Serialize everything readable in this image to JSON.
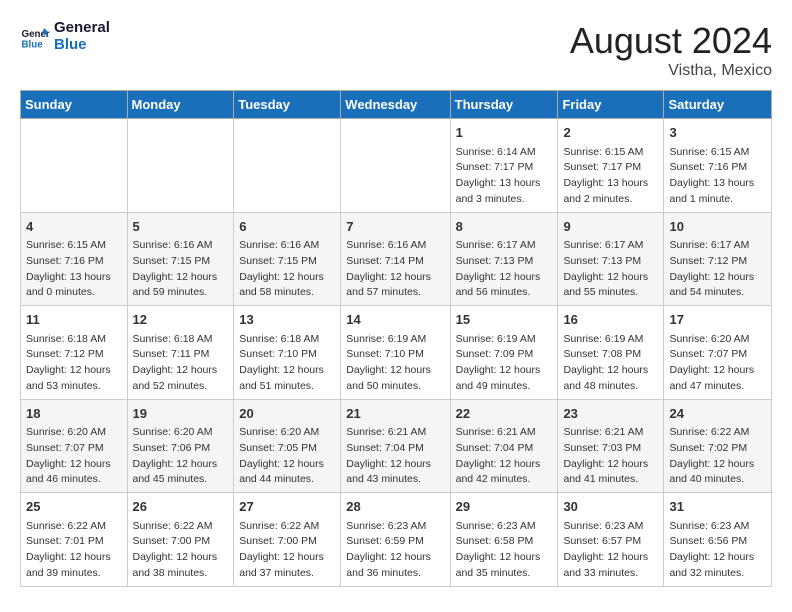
{
  "header": {
    "logo_line1": "General",
    "logo_line2": "Blue",
    "month": "August 2024",
    "location": "Vistha, Mexico"
  },
  "days_of_week": [
    "Sunday",
    "Monday",
    "Tuesday",
    "Wednesday",
    "Thursday",
    "Friday",
    "Saturday"
  ],
  "weeks": [
    [
      {
        "day": "",
        "content": ""
      },
      {
        "day": "",
        "content": ""
      },
      {
        "day": "",
        "content": ""
      },
      {
        "day": "",
        "content": ""
      },
      {
        "day": "1",
        "content": "Sunrise: 6:14 AM\nSunset: 7:17 PM\nDaylight: 13 hours\nand 3 minutes."
      },
      {
        "day": "2",
        "content": "Sunrise: 6:15 AM\nSunset: 7:17 PM\nDaylight: 13 hours\nand 2 minutes."
      },
      {
        "day": "3",
        "content": "Sunrise: 6:15 AM\nSunset: 7:16 PM\nDaylight: 13 hours\nand 1 minute."
      }
    ],
    [
      {
        "day": "4",
        "content": "Sunrise: 6:15 AM\nSunset: 7:16 PM\nDaylight: 13 hours\nand 0 minutes."
      },
      {
        "day": "5",
        "content": "Sunrise: 6:16 AM\nSunset: 7:15 PM\nDaylight: 12 hours\nand 59 minutes."
      },
      {
        "day": "6",
        "content": "Sunrise: 6:16 AM\nSunset: 7:15 PM\nDaylight: 12 hours\nand 58 minutes."
      },
      {
        "day": "7",
        "content": "Sunrise: 6:16 AM\nSunset: 7:14 PM\nDaylight: 12 hours\nand 57 minutes."
      },
      {
        "day": "8",
        "content": "Sunrise: 6:17 AM\nSunset: 7:13 PM\nDaylight: 12 hours\nand 56 minutes."
      },
      {
        "day": "9",
        "content": "Sunrise: 6:17 AM\nSunset: 7:13 PM\nDaylight: 12 hours\nand 55 minutes."
      },
      {
        "day": "10",
        "content": "Sunrise: 6:17 AM\nSunset: 7:12 PM\nDaylight: 12 hours\nand 54 minutes."
      }
    ],
    [
      {
        "day": "11",
        "content": "Sunrise: 6:18 AM\nSunset: 7:12 PM\nDaylight: 12 hours\nand 53 minutes."
      },
      {
        "day": "12",
        "content": "Sunrise: 6:18 AM\nSunset: 7:11 PM\nDaylight: 12 hours\nand 52 minutes."
      },
      {
        "day": "13",
        "content": "Sunrise: 6:18 AM\nSunset: 7:10 PM\nDaylight: 12 hours\nand 51 minutes."
      },
      {
        "day": "14",
        "content": "Sunrise: 6:19 AM\nSunset: 7:10 PM\nDaylight: 12 hours\nand 50 minutes."
      },
      {
        "day": "15",
        "content": "Sunrise: 6:19 AM\nSunset: 7:09 PM\nDaylight: 12 hours\nand 49 minutes."
      },
      {
        "day": "16",
        "content": "Sunrise: 6:19 AM\nSunset: 7:08 PM\nDaylight: 12 hours\nand 48 minutes."
      },
      {
        "day": "17",
        "content": "Sunrise: 6:20 AM\nSunset: 7:07 PM\nDaylight: 12 hours\nand 47 minutes."
      }
    ],
    [
      {
        "day": "18",
        "content": "Sunrise: 6:20 AM\nSunset: 7:07 PM\nDaylight: 12 hours\nand 46 minutes."
      },
      {
        "day": "19",
        "content": "Sunrise: 6:20 AM\nSunset: 7:06 PM\nDaylight: 12 hours\nand 45 minutes."
      },
      {
        "day": "20",
        "content": "Sunrise: 6:20 AM\nSunset: 7:05 PM\nDaylight: 12 hours\nand 44 minutes."
      },
      {
        "day": "21",
        "content": "Sunrise: 6:21 AM\nSunset: 7:04 PM\nDaylight: 12 hours\nand 43 minutes."
      },
      {
        "day": "22",
        "content": "Sunrise: 6:21 AM\nSunset: 7:04 PM\nDaylight: 12 hours\nand 42 minutes."
      },
      {
        "day": "23",
        "content": "Sunrise: 6:21 AM\nSunset: 7:03 PM\nDaylight: 12 hours\nand 41 minutes."
      },
      {
        "day": "24",
        "content": "Sunrise: 6:22 AM\nSunset: 7:02 PM\nDaylight: 12 hours\nand 40 minutes."
      }
    ],
    [
      {
        "day": "25",
        "content": "Sunrise: 6:22 AM\nSunset: 7:01 PM\nDaylight: 12 hours\nand 39 minutes."
      },
      {
        "day": "26",
        "content": "Sunrise: 6:22 AM\nSunset: 7:00 PM\nDaylight: 12 hours\nand 38 minutes."
      },
      {
        "day": "27",
        "content": "Sunrise: 6:22 AM\nSunset: 7:00 PM\nDaylight: 12 hours\nand 37 minutes."
      },
      {
        "day": "28",
        "content": "Sunrise: 6:23 AM\nSunset: 6:59 PM\nDaylight: 12 hours\nand 36 minutes."
      },
      {
        "day": "29",
        "content": "Sunrise: 6:23 AM\nSunset: 6:58 PM\nDaylight: 12 hours\nand 35 minutes."
      },
      {
        "day": "30",
        "content": "Sunrise: 6:23 AM\nSunset: 6:57 PM\nDaylight: 12 hours\nand 33 minutes."
      },
      {
        "day": "31",
        "content": "Sunrise: 6:23 AM\nSunset: 6:56 PM\nDaylight: 12 hours\nand 32 minutes."
      }
    ]
  ]
}
